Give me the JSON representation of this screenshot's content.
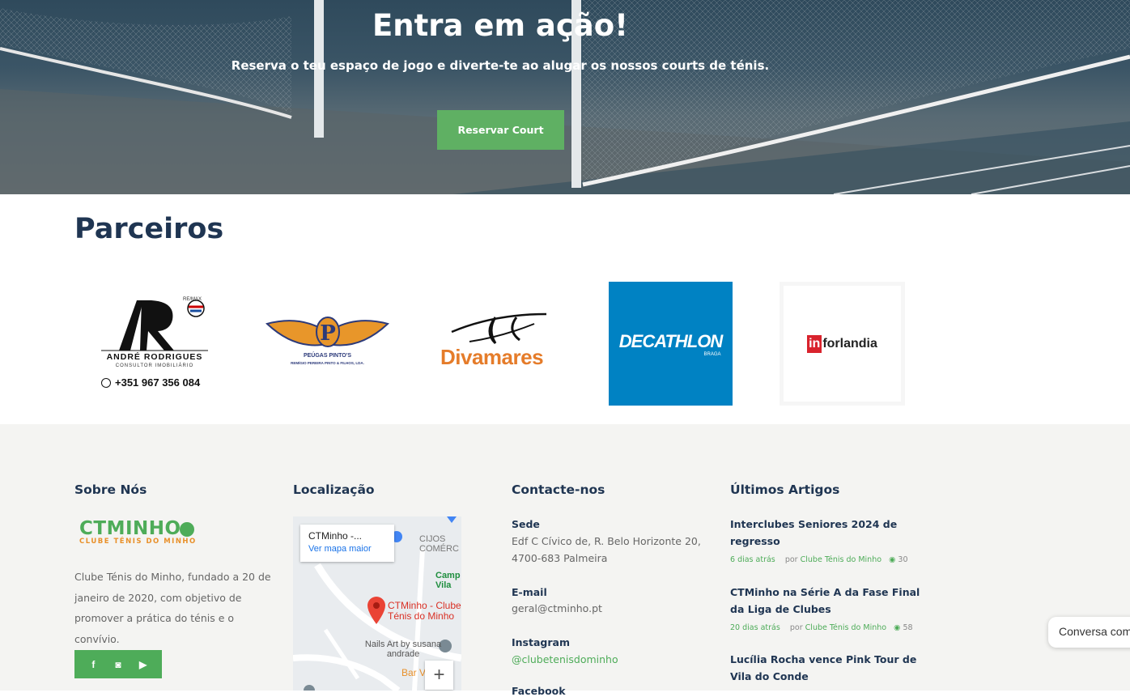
{
  "hero": {
    "title": "Entra em ação!",
    "subtitle": "Reserva o teu espaço de jogo e diverte-te ao alugar os nossos courts de ténis.",
    "button": "Reservar Court",
    "button_color": "#5fb063"
  },
  "partners": {
    "title": "Parceiros",
    "andre": {
      "name": "ANDRÉ RODRIGUES",
      "subtitle": "CONSULTOR IMOBILIÁRIO",
      "brand": "RE/MAX",
      "phone": "+351 967 356 084"
    },
    "pinto": {
      "name": "PEÚGAS PINTO'S",
      "subtitle": "REMÍGIO PEREIRA PINTO & FILHOS, LDA."
    },
    "divamares": {
      "name": "Divamares"
    },
    "decathlon": {
      "name": "DECATHLON",
      "sub": "BRAGA",
      "color": "#0082c3"
    },
    "inforlandia": {
      "prefix": "in",
      "name": "forlandia"
    }
  },
  "footer": {
    "about": {
      "title": "Sobre Nós",
      "logo_name": "CTMINHO",
      "logo_sub": "CLUBE TÉNIS DO MINHO",
      "text": "Clube Ténis do Minho, fundado a 20 de janeiro de 2020, com objetivo de promover a prática do ténis e o convívio.",
      "social": {
        "facebook": "f",
        "instagram": "◙",
        "youtube": "▶"
      }
    },
    "location": {
      "title": "Localização",
      "card_title": "CTMinho -...",
      "card_link": "Ver mapa maior",
      "labels": {
        "pin": "CTMinho - Clube Ténis do Minho",
        "nails": "Nails Art by susana andrade",
        "cijos": "CIJOS COMÉRC",
        "camp": "Camp Vila",
        "bar": "Bar V"
      },
      "zoom": "+"
    },
    "contact": {
      "title": "Contacte-nos",
      "sede_label": "Sede",
      "sede_line1": "Edf C Cívico de, R. Belo Horizonte 20,",
      "sede_line2": "4700-683 Palmeira",
      "email_label": "E-mail",
      "email": "geral@ctminho.pt",
      "instagram_label": "Instagram",
      "instagram": "@clubetenisdominho",
      "facebook_label": "Facebook"
    },
    "articles": {
      "title": "Últimos Artigos",
      "items": [
        {
          "title": "Interclubes Seniores 2024 de regresso",
          "time": "6 dias atrás",
          "by": "por",
          "author": "Clube Ténis do Minho",
          "views": "30"
        },
        {
          "title": "CTMinho na Série A da Fase Final da Liga de Clubes",
          "time": "20 dias atrás",
          "by": "por",
          "author": "Clube Ténis do Minho",
          "views": "58"
        },
        {
          "title": "Lucília Rocha vence Pink Tour de Vila do Conde"
        }
      ]
    }
  },
  "chat": {
    "label": "Conversa com"
  }
}
